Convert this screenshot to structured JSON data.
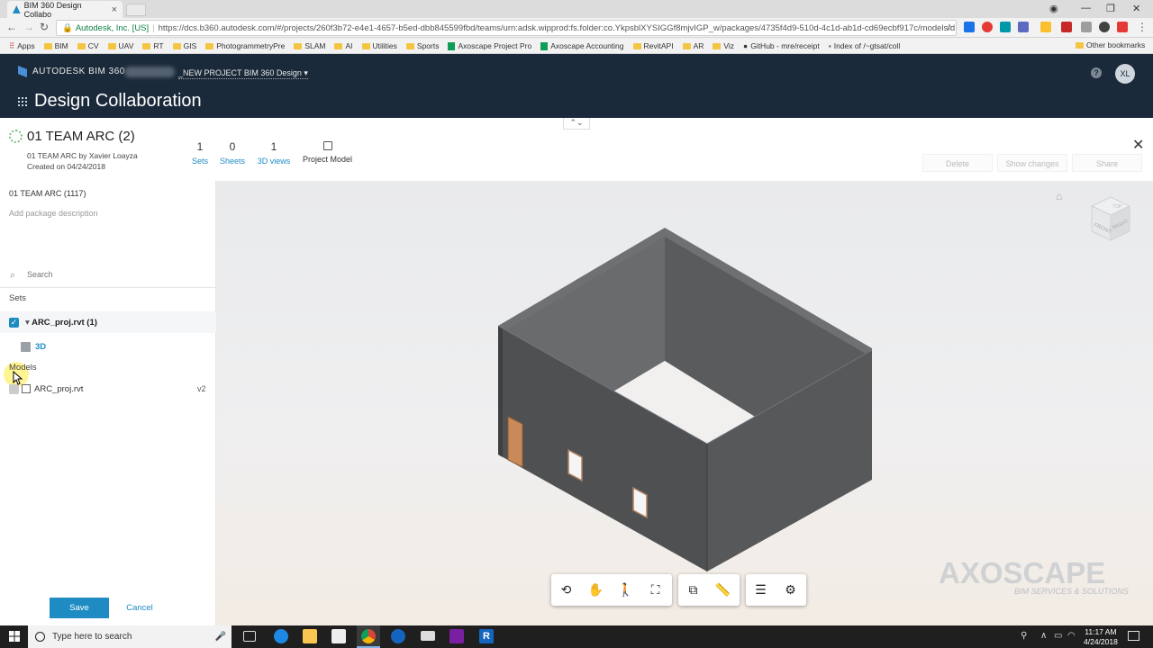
{
  "browser": {
    "tab_title": "BIM 360 Design Collabo",
    "site_name": "Autodesk, Inc. [US]",
    "url": "https://dcs.b360.autodesk.com/#/projects/260f3b72-e4e1-4657-b5ed-dbb845599fbd/teams/urn:adsk.wipprod:fs.folder:co.YkpsblXYSIGGf8mjvIGP_w/packages/4735f4d9-510d-4c1d-ab1d-cd69ecbf917c/models/d...",
    "bookmarks": [
      {
        "label": "Apps",
        "kind": "apps"
      },
      {
        "label": "BIM",
        "kind": "folder"
      },
      {
        "label": "CV",
        "kind": "folder"
      },
      {
        "label": "UAV",
        "kind": "folder"
      },
      {
        "label": "RT",
        "kind": "folder"
      },
      {
        "label": "GIS",
        "kind": "folder"
      },
      {
        "label": "PhotogrammetryPre",
        "kind": "folder"
      },
      {
        "label": "SLAM",
        "kind": "folder"
      },
      {
        "label": "AI",
        "kind": "folder"
      },
      {
        "label": "Utilities",
        "kind": "folder"
      },
      {
        "label": "Sports",
        "kind": "folder"
      },
      {
        "label": "Axoscape Project Pro",
        "kind": "sheet"
      },
      {
        "label": "Axoscape Accounting",
        "kind": "sheet"
      },
      {
        "label": "RevitAPI",
        "kind": "folder"
      },
      {
        "label": "AR",
        "kind": "folder"
      },
      {
        "label": "Viz",
        "kind": "folder"
      },
      {
        "label": "GitHub - mre/receipt",
        "kind": "github"
      },
      {
        "label": "Index of /~gtsat/coll",
        "kind": "page"
      }
    ],
    "other_bookmarks": "Other bookmarks"
  },
  "app": {
    "brand": "AUTODESK BIM 360",
    "project": "_NEW PROJECT BIM 360 Design",
    "title": "Design Collaboration",
    "help": "?",
    "avatar_initials": "XL"
  },
  "package": {
    "title": "01 TEAM ARC (2)",
    "by": "01 TEAM ARC by Xavier Loayza",
    "created": "Created on 04/24/2018",
    "stats": [
      {
        "count": "1",
        "label": "Sets"
      },
      {
        "count": "0",
        "label": "Sheets"
      },
      {
        "count": "1",
        "label": "3D views"
      }
    ],
    "project_model": "Project Model",
    "actions": {
      "delete": "Delete",
      "show_changes": "Show changes",
      "share": "Share"
    }
  },
  "left_panel": {
    "package_name": "01 TEAM ARC (1117)",
    "description_placeholder": "Add package description",
    "search_placeholder": "Search",
    "sets_label": "Sets",
    "set_item": "ARC_proj.rvt (1)",
    "view_3d": "3D",
    "models_label": "Models",
    "model_name": "ARC_proj.rvt",
    "model_version": "v2",
    "save": "Save",
    "cancel": "Cancel"
  },
  "viewer": {
    "viewcube_faces": {
      "top": "TOP",
      "front": "FRONT",
      "right": "RIGHT"
    },
    "watermark_brand": "AXOSCAPE",
    "watermark_tagline": "BIM SERVICES & SOLUTIONS"
  },
  "taskbar": {
    "search_placeholder": "Type here to search",
    "time": "11:17 AM",
    "date": "4/24/2018"
  },
  "colors": {
    "accent": "#1e8bc3",
    "header": "#1b2a3a",
    "wall": "#555657"
  }
}
